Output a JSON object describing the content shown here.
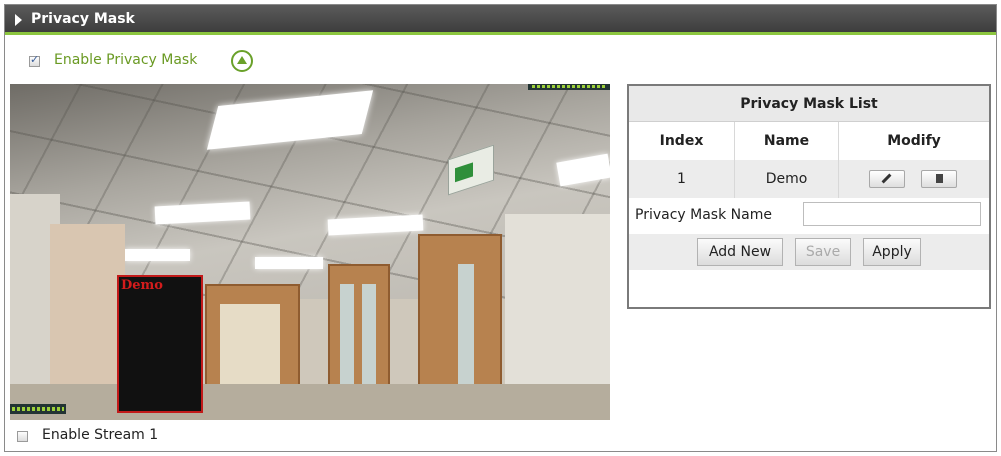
{
  "header": {
    "title": "Privacy Mask"
  },
  "privacy": {
    "enable_label": "Enable Privacy Mask",
    "enabled": true
  },
  "camera": {
    "mask_label": "Demo"
  },
  "stream": {
    "enable_label": "Enable Stream 1",
    "enabled": false
  },
  "mask_list": {
    "title": "Privacy Mask List",
    "columns": [
      "Index",
      "Name",
      "Modify"
    ],
    "rows": [
      {
        "index": "1",
        "name": "Demo"
      }
    ],
    "name_label": "Privacy Mask Name",
    "name_value": "",
    "buttons": {
      "add_new": "Add New",
      "save": "Save",
      "apply": "Apply"
    }
  },
  "colors": {
    "accent_green": "#8cc63f",
    "mask_red": "#c21a1a"
  },
  "icons": [
    "expand-triangle-icon",
    "collapse-up-icon",
    "pencil-icon",
    "trash-icon"
  ]
}
